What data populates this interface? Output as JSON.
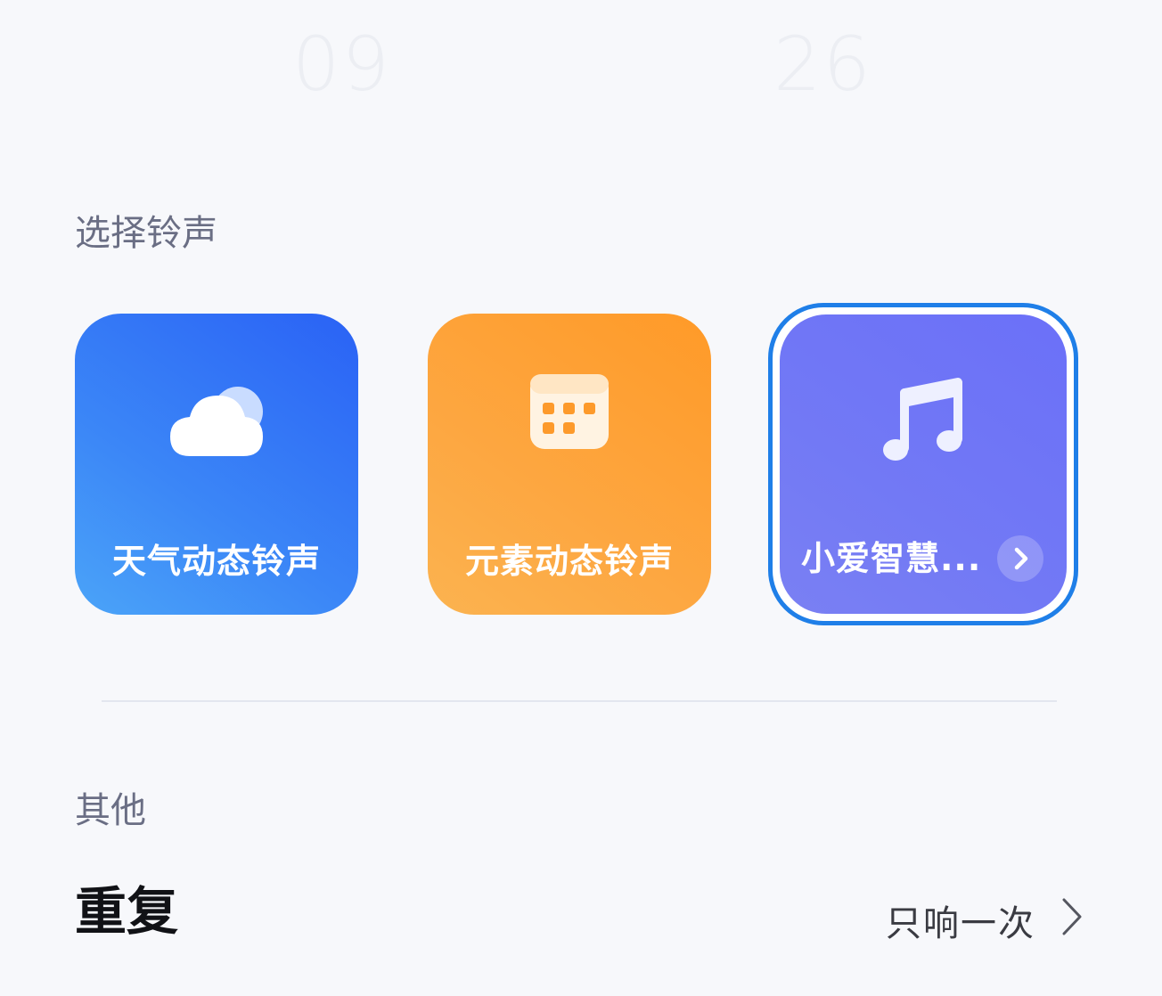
{
  "time_picker": {
    "hours": "09",
    "minutes": "26"
  },
  "ringtone_section": {
    "title": "选择铃声",
    "cards": [
      {
        "label": "天气动态铃声",
        "icon": "cloud-icon",
        "color": "#2f6ff6"
      },
      {
        "label": "元素动态铃声",
        "icon": "calendar-grid-icon",
        "color": "#fda33a"
      },
      {
        "label": "小爱智慧...",
        "icon": "music-note-icon",
        "color": "#6f75f6",
        "selected": true
      }
    ]
  },
  "other_section": {
    "title": "其他",
    "repeat": {
      "label": "重复",
      "value": "只响一次"
    }
  },
  "colors": {
    "accent_border": "#1f7fe8",
    "background": "#f7f8fb"
  }
}
